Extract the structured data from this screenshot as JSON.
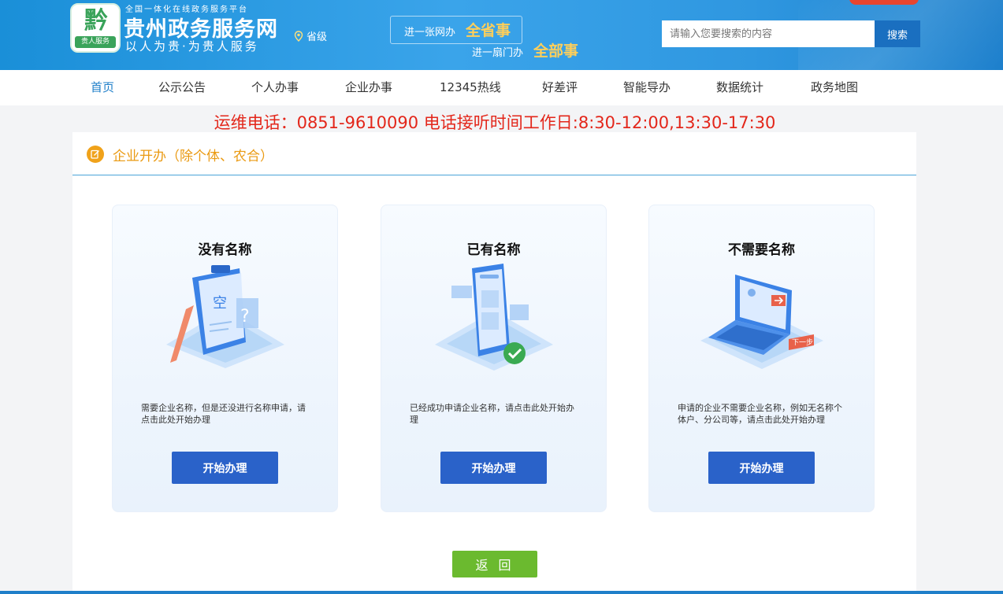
{
  "header": {
    "logo_glyph": "黔",
    "logo_tag": "贵人服务",
    "top_line": "全国一体化在线政务服务平台",
    "site_title": "贵州政务服务网",
    "slogan": "以人为贵·为贵人服务",
    "location": "省级",
    "banner": {
      "line1": "进一张网办",
      "line1_emphasis": "全省事",
      "line2": "进一扇门办",
      "line2_emphasis": "全部事"
    },
    "search": {
      "placeholder": "请输入您要搜索的内容",
      "button": "搜索"
    }
  },
  "nav": {
    "items": [
      {
        "label": "首页",
        "active": true
      },
      {
        "label": "公示公告"
      },
      {
        "label": "个人办事"
      },
      {
        "label": "企业办事"
      },
      {
        "label": "12345热线"
      },
      {
        "label": "好差评"
      },
      {
        "label": "智能导办"
      },
      {
        "label": "数据统计"
      },
      {
        "label": "政务地图"
      }
    ]
  },
  "hotline": "运维电话：0851-9610090 电话接听时间工作日:8:30-12:00,13:30-17:30",
  "section": {
    "title": "企业开办（除个体、农合）"
  },
  "cards": [
    {
      "title": "没有名称",
      "description": "需要企业名称，但是还没进行名称申请，请点击此处开始办理",
      "button": "开始办理",
      "illustration": "clipboard-question-icon"
    },
    {
      "title": "已有名称",
      "description": "已经成功申请企业名称，请点击此处开始办理",
      "button": "开始办理",
      "illustration": "phone-check-icon"
    },
    {
      "title": "不需要名称",
      "description": "申请的企业不需要企业名称，例如无名称个体户、分公司等，请点击此处开始办理",
      "button": "开始办理",
      "illustration": "laptop-next-step-icon",
      "illustration_label": "下一步"
    }
  ],
  "back_button": "返 回",
  "colors": {
    "header_blue": "#2f97e0",
    "accent_orange": "#ea9a12",
    "hotline_red": "#e3261a",
    "button_blue": "#2a62c9",
    "back_green": "#6bba2f"
  }
}
